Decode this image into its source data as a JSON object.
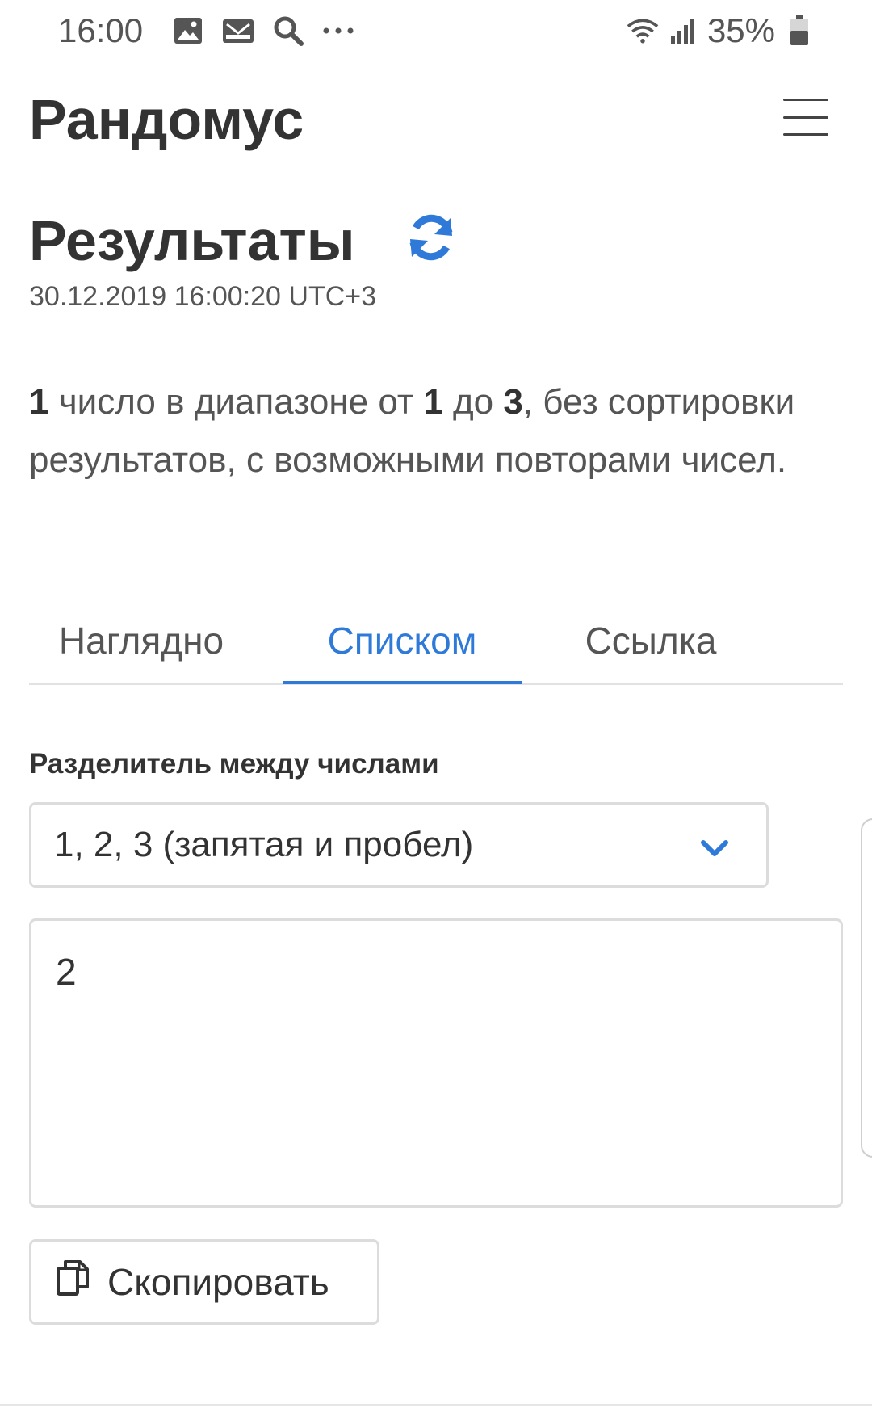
{
  "status_bar": {
    "time": "16:00",
    "battery_percent": "35%",
    "icons": [
      "gallery-icon",
      "mail-icon",
      "search-icon",
      "more-icon",
      "wifi-icon",
      "signal-icon",
      "battery-icon"
    ]
  },
  "header": {
    "app_title": "Рандомус",
    "menu_icon": "hamburger-menu-icon"
  },
  "results": {
    "title": "Результаты",
    "refresh_icon": "refresh-icon",
    "timestamp": "30.12.2019 16:00:20 UTC+3"
  },
  "description": {
    "count": "1",
    "text_1": " число в диапазоне от ",
    "from": "1",
    "text_2": " до ",
    "to": "3",
    "text_3": ", без сортировки результатов, с возможными повторами чисел."
  },
  "tabs": [
    {
      "label": "Наглядно",
      "active": false
    },
    {
      "label": "Списком",
      "active": true
    },
    {
      "label": "Ссылка",
      "active": false
    }
  ],
  "separator": {
    "label": "Разделитель между числами",
    "selected": "1, 2, 3 (запятая и пробел)"
  },
  "result_value": "2",
  "copy_button": {
    "label": "Скопировать",
    "icon": "copy-icon"
  },
  "colors": {
    "accent": "#2f7ad9",
    "text": "#333333",
    "muted": "#555555",
    "border": "#dcdcdc"
  }
}
